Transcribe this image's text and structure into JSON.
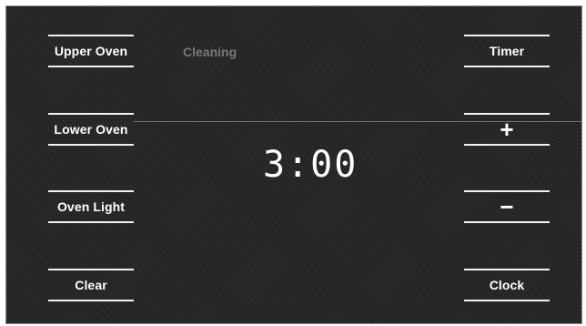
{
  "left_keys": {
    "upper_oven": "Upper Oven",
    "lower_oven": "Lower Oven",
    "oven_light": "Oven Light",
    "clear": "Clear"
  },
  "right_keys": {
    "timer": "Timer",
    "plus": "+",
    "minus": "−",
    "clock": "Clock"
  },
  "display": {
    "status": "Cleaning",
    "time": "3:00"
  },
  "colors": {
    "panel_background": "#262626",
    "label": "#ffffff",
    "status_text": "#7a7a7a"
  }
}
